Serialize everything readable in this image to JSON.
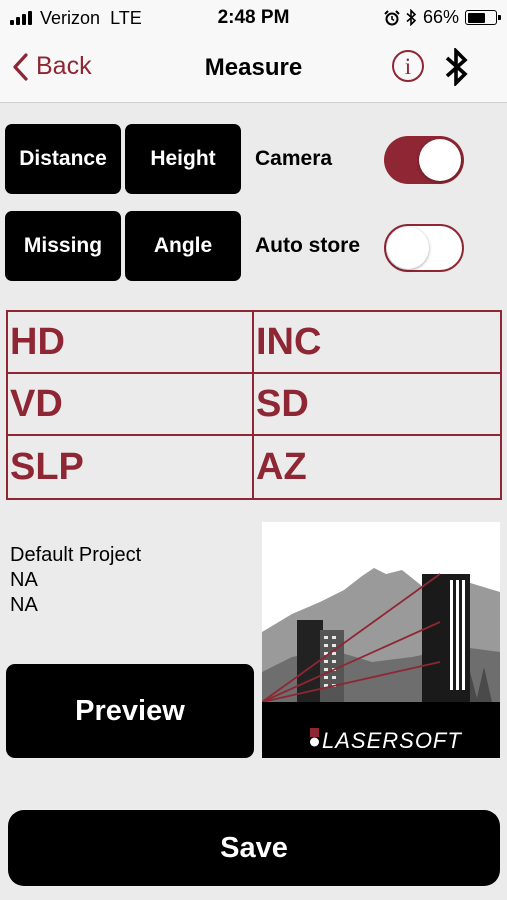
{
  "status_bar": {
    "carrier": "Verizon",
    "network": "LTE",
    "time": "2:48 PM",
    "battery_percent": "66%",
    "battery_level": 0.66,
    "icons": [
      "alarm-icon",
      "bluetooth-icon",
      "battery-icon"
    ]
  },
  "nav": {
    "back_label": "Back",
    "title": "Measure",
    "info_glyph": "i"
  },
  "modes": {
    "distance": "Distance",
    "height": "Height",
    "missing": "Missing",
    "angle": "Angle"
  },
  "options": {
    "camera_label": "Camera",
    "camera_on": true,
    "auto_store_label": "Auto store",
    "auto_store_on": false
  },
  "readings": [
    "HD",
    "INC",
    "VD",
    "SD",
    "SLP",
    "AZ"
  ],
  "project": {
    "name": "Default Project",
    "line2": "NA",
    "line3": "NA"
  },
  "buttons": {
    "preview": "Preview",
    "save": "Save"
  },
  "logo": {
    "text": "LASERSOFT",
    "icon": "lasersoft-logo"
  },
  "colors": {
    "accent": "#8e2634",
    "background": "#ebebeb",
    "button": "#000000"
  }
}
